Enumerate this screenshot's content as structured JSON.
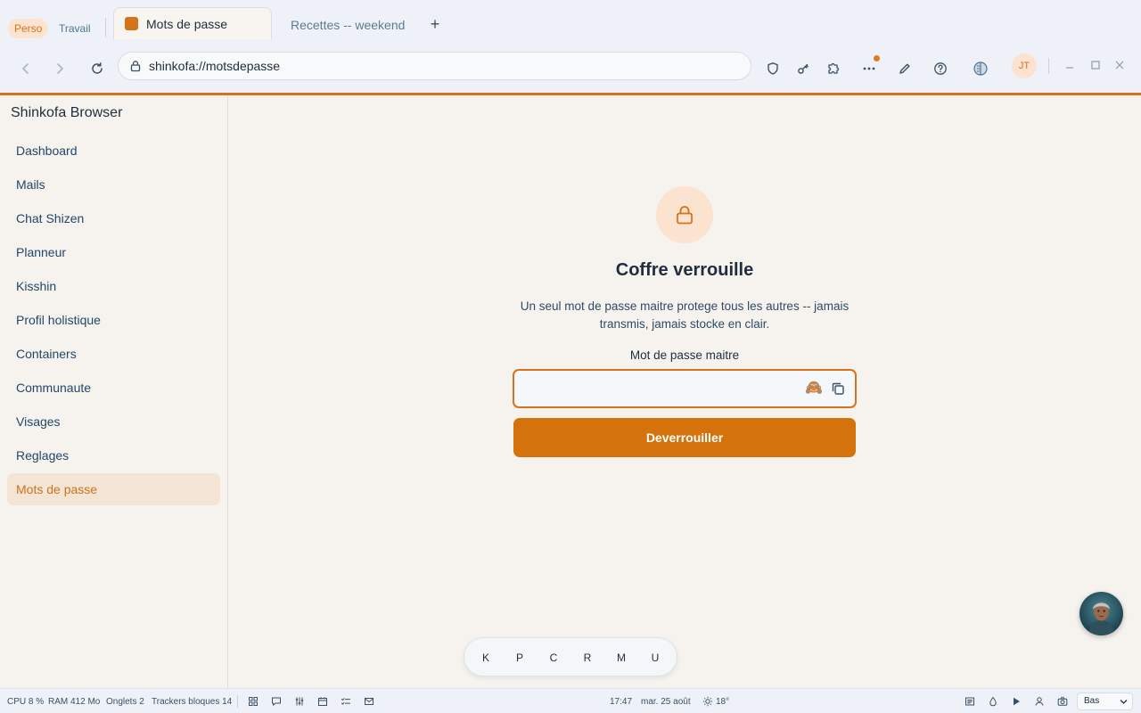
{
  "profiles": [
    {
      "label": "Perso",
      "active": true
    },
    {
      "label": "Travail",
      "active": false
    }
  ],
  "tabs": [
    {
      "title": "Mots de passe",
      "active": true
    },
    {
      "title": "Recettes -- weekend",
      "active": false
    }
  ],
  "new_tab_label": "+",
  "address_bar": {
    "url": "shinkofa://motsdepasse"
  },
  "user": {
    "initials": "JT"
  },
  "sidebar": {
    "brand": "Shinkofa Browser",
    "items": [
      {
        "label": "Dashboard"
      },
      {
        "label": "Mails"
      },
      {
        "label": "Chat Shizen"
      },
      {
        "label": "Planneur"
      },
      {
        "label": "Kisshin"
      },
      {
        "label": "Profil holistique"
      },
      {
        "label": "Containers"
      },
      {
        "label": "Communaute"
      },
      {
        "label": "Visages"
      },
      {
        "label": "Reglages"
      },
      {
        "label": "Mots de passe"
      }
    ],
    "active_item": "Mots de passe"
  },
  "vault": {
    "title": "Coffre verrouille",
    "description": "Un seul mot de passe maitre protege tous les autres -- jamais transmis, jamais stocke en clair.",
    "field_label": "Mot de passe maitre",
    "password_value": "",
    "eye_glyph": "🙈",
    "unlock_label": "Deverrouiller"
  },
  "dock": {
    "keys": [
      "K",
      "P",
      "C",
      "R",
      "M",
      "U"
    ]
  },
  "status": {
    "cpu": "CPU 8 %",
    "ram": "RAM 412 Mo",
    "tabs": "Onglets 2",
    "trackers": "Trackers bloques 14",
    "time": "17:47",
    "date": "mar. 25 août",
    "weather": "18°",
    "level": "Bas"
  },
  "colors": {
    "accent": "#d4731a",
    "button": "#d4730c",
    "sidebar_active_bg": "#f4e4d4",
    "background": "#f6f3ee",
    "chrome": "#eef2f8"
  },
  "icons": {
    "toolbar": [
      "shield-icon",
      "key-icon",
      "puzzle-icon",
      "more-icon",
      "pen-icon",
      "help-icon",
      "split-view-icon"
    ],
    "status": [
      "grid-icon",
      "chat-icon",
      "sliders-icon",
      "calendar-icon",
      "checklist-icon",
      "mail-icon",
      "reader-icon",
      "drop-icon",
      "play-icon",
      "person-icon",
      "camera-icon"
    ]
  }
}
